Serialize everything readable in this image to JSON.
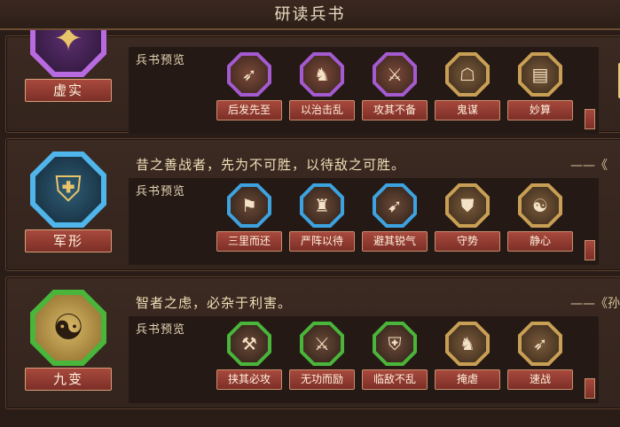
{
  "header": {
    "title": "研读兵书"
  },
  "panel_label": "兵书预览",
  "colors": {
    "purple": "#9a48c9",
    "blue": "#3da3e0",
    "green": "#49b53a",
    "gold": "#c89f54"
  },
  "cards": [
    {
      "name": "虚实",
      "icon": "xushi-emblem-icon",
      "quote": "",
      "source": "",
      "skills": [
        {
          "label": "后发先至",
          "icon": "bow-strike-icon",
          "tier": "purple"
        },
        {
          "label": "以治击乱",
          "icon": "cavalry-icon",
          "tier": "purple"
        },
        {
          "label": "攻其不备",
          "icon": "ambush-icon",
          "tier": "purple"
        },
        {
          "label": "鬼谋",
          "icon": "strategist-icon",
          "tier": "gold"
        },
        {
          "label": "妙算",
          "icon": "scroll-icon",
          "tier": "gold"
        }
      ]
    },
    {
      "name": "军形",
      "icon": "junxing-emblem-icon",
      "quote": "昔之善战者，先为不可胜，以待敌之可胜。",
      "source": "——《",
      "skills": [
        {
          "label": "三里而还",
          "icon": "retreat-icon",
          "tier": "blue"
        },
        {
          "label": "严阵以待",
          "icon": "formation-icon",
          "tier": "blue"
        },
        {
          "label": "避其锐气",
          "icon": "evade-icon",
          "tier": "blue"
        },
        {
          "label": "守势",
          "icon": "defense-icon",
          "tier": "gold"
        },
        {
          "label": "静心",
          "icon": "meditate-icon",
          "tier": "gold"
        }
      ]
    },
    {
      "name": "九变",
      "icon": "yin-yang-icon",
      "quote": "智者之虑，必杂于利害。",
      "source": "——《孙",
      "skills": [
        {
          "label": "挟其必攻",
          "icon": "siege-icon",
          "tier": "green"
        },
        {
          "label": "无功而励",
          "icon": "encourage-icon",
          "tier": "green"
        },
        {
          "label": "临敌不乱",
          "icon": "steady-icon",
          "tier": "green"
        },
        {
          "label": "掩虐",
          "icon": "cover-icon",
          "tier": "gold"
        },
        {
          "label": "速战",
          "icon": "swift-icon",
          "tier": "gold"
        }
      ]
    }
  ]
}
